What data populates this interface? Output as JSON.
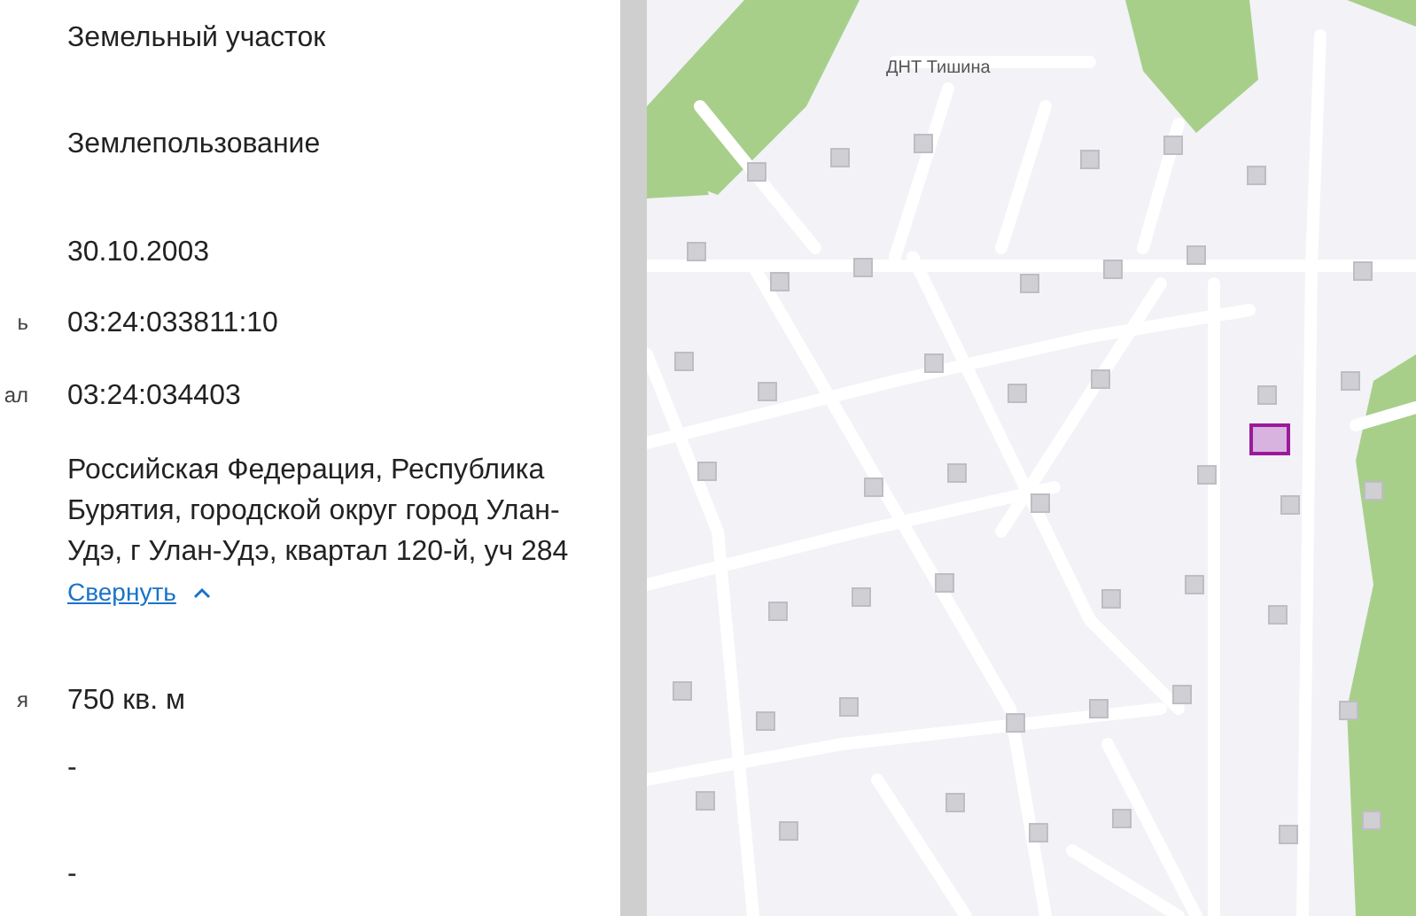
{
  "details": [
    {
      "value": "Земельный участок"
    },
    {
      "value": "Землепользование"
    },
    {
      "value": "30.10.2003"
    },
    {
      "label": "ь",
      "value": "03:24:033811:10"
    },
    {
      "label": "ал",
      "value": "03:24:034403"
    },
    {
      "value": "Российская Федерация, Республика Бурятия, городской округ город Улан-Удэ, г Улан-Удэ, квартал 120-й, уч 284",
      "toggle": {
        "label": "Свернуть",
        "expanded": true
      }
    },
    {
      "label": "я",
      "value": "750 кв. м"
    },
    {
      "value": "-"
    },
    {
      "value": "-"
    }
  ],
  "map": {
    "place_label": "ДНТ Тишина"
  }
}
